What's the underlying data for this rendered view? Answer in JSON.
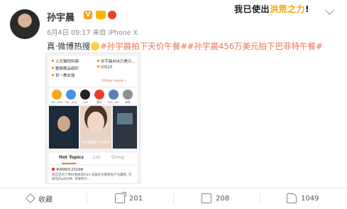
{
  "post": {
    "username": "孙宇晨",
    "verified_badge": "V",
    "meta": "6月4日 09:17 来自 iPhone X",
    "brand_banner_a": "我已使出",
    "brand_banner_b": "洪荒之力",
    "brand_banner_c": "!",
    "text_prefix": "真·微博热搜",
    "hashtag": "#孙宇晨拍下天价午餐##孙宇晨456万美元拍下巴菲特午餐#"
  },
  "screenshot": {
    "hot_items": [
      "上天猫找科鼎",
      "孙宇晨456万美元...",
      "魅族精品组织",
      "iOS13",
      "世一教女授"
    ],
    "show_more": "Show more ›",
    "apps": [
      {
        "label": "No...end",
        "color": "#f5a623"
      },
      {
        "label": "Hu...ong",
        "color": "#4a90e2"
      },
      {
        "label": "Live",
        "color": "#222222"
      },
      {
        "label": "娱乐",
        "color": "#e8402a"
      },
      {
        "label": "Life...ser",
        "color": "#5b7fb5"
      },
      {
        "label": "体育",
        "color": "#8e8e93"
      }
    ],
    "media_caption": "孙宇晨拍下天价午...",
    "tabs": [
      "Hot Topics",
      "List",
      "Group"
    ],
    "feed_tag": "#WWDC2019#",
    "feed_text": "现在连为了更好地体验iPad 设备的大家和生产力属性, 在新的iPadOS中, 苹果终于..."
  },
  "actions": {
    "favorite_label": "收藏",
    "share_count": "201",
    "comment_count": "208",
    "like_count": "1049"
  }
}
